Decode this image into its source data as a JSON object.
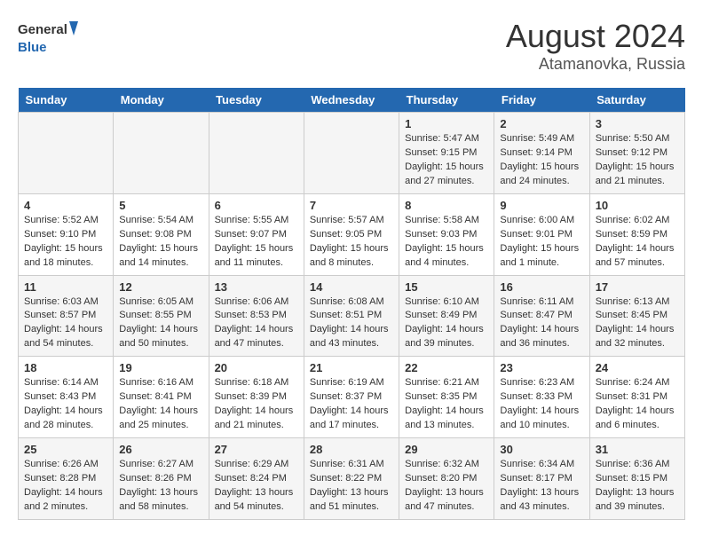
{
  "header": {
    "logo_line1": "General",
    "logo_line2": "Blue",
    "calendar_title": "August 2024",
    "calendar_subtitle": "Atamanovka, Russia"
  },
  "weekdays": [
    "Sunday",
    "Monday",
    "Tuesday",
    "Wednesday",
    "Thursday",
    "Friday",
    "Saturday"
  ],
  "weeks": [
    [
      {
        "day": "",
        "info": ""
      },
      {
        "day": "",
        "info": ""
      },
      {
        "day": "",
        "info": ""
      },
      {
        "day": "",
        "info": ""
      },
      {
        "day": "1",
        "info": "Sunrise: 5:47 AM\nSunset: 9:15 PM\nDaylight: 15 hours\nand 27 minutes."
      },
      {
        "day": "2",
        "info": "Sunrise: 5:49 AM\nSunset: 9:14 PM\nDaylight: 15 hours\nand 24 minutes."
      },
      {
        "day": "3",
        "info": "Sunrise: 5:50 AM\nSunset: 9:12 PM\nDaylight: 15 hours\nand 21 minutes."
      }
    ],
    [
      {
        "day": "4",
        "info": "Sunrise: 5:52 AM\nSunset: 9:10 PM\nDaylight: 15 hours\nand 18 minutes."
      },
      {
        "day": "5",
        "info": "Sunrise: 5:54 AM\nSunset: 9:08 PM\nDaylight: 15 hours\nand 14 minutes."
      },
      {
        "day": "6",
        "info": "Sunrise: 5:55 AM\nSunset: 9:07 PM\nDaylight: 15 hours\nand 11 minutes."
      },
      {
        "day": "7",
        "info": "Sunrise: 5:57 AM\nSunset: 9:05 PM\nDaylight: 15 hours\nand 8 minutes."
      },
      {
        "day": "8",
        "info": "Sunrise: 5:58 AM\nSunset: 9:03 PM\nDaylight: 15 hours\nand 4 minutes."
      },
      {
        "day": "9",
        "info": "Sunrise: 6:00 AM\nSunset: 9:01 PM\nDaylight: 15 hours\nand 1 minute."
      },
      {
        "day": "10",
        "info": "Sunrise: 6:02 AM\nSunset: 8:59 PM\nDaylight: 14 hours\nand 57 minutes."
      }
    ],
    [
      {
        "day": "11",
        "info": "Sunrise: 6:03 AM\nSunset: 8:57 PM\nDaylight: 14 hours\nand 54 minutes."
      },
      {
        "day": "12",
        "info": "Sunrise: 6:05 AM\nSunset: 8:55 PM\nDaylight: 14 hours\nand 50 minutes."
      },
      {
        "day": "13",
        "info": "Sunrise: 6:06 AM\nSunset: 8:53 PM\nDaylight: 14 hours\nand 47 minutes."
      },
      {
        "day": "14",
        "info": "Sunrise: 6:08 AM\nSunset: 8:51 PM\nDaylight: 14 hours\nand 43 minutes."
      },
      {
        "day": "15",
        "info": "Sunrise: 6:10 AM\nSunset: 8:49 PM\nDaylight: 14 hours\nand 39 minutes."
      },
      {
        "day": "16",
        "info": "Sunrise: 6:11 AM\nSunset: 8:47 PM\nDaylight: 14 hours\nand 36 minutes."
      },
      {
        "day": "17",
        "info": "Sunrise: 6:13 AM\nSunset: 8:45 PM\nDaylight: 14 hours\nand 32 minutes."
      }
    ],
    [
      {
        "day": "18",
        "info": "Sunrise: 6:14 AM\nSunset: 8:43 PM\nDaylight: 14 hours\nand 28 minutes."
      },
      {
        "day": "19",
        "info": "Sunrise: 6:16 AM\nSunset: 8:41 PM\nDaylight: 14 hours\nand 25 minutes."
      },
      {
        "day": "20",
        "info": "Sunrise: 6:18 AM\nSunset: 8:39 PM\nDaylight: 14 hours\nand 21 minutes."
      },
      {
        "day": "21",
        "info": "Sunrise: 6:19 AM\nSunset: 8:37 PM\nDaylight: 14 hours\nand 17 minutes."
      },
      {
        "day": "22",
        "info": "Sunrise: 6:21 AM\nSunset: 8:35 PM\nDaylight: 14 hours\nand 13 minutes."
      },
      {
        "day": "23",
        "info": "Sunrise: 6:23 AM\nSunset: 8:33 PM\nDaylight: 14 hours\nand 10 minutes."
      },
      {
        "day": "24",
        "info": "Sunrise: 6:24 AM\nSunset: 8:31 PM\nDaylight: 14 hours\nand 6 minutes."
      }
    ],
    [
      {
        "day": "25",
        "info": "Sunrise: 6:26 AM\nSunset: 8:28 PM\nDaylight: 14 hours\nand 2 minutes."
      },
      {
        "day": "26",
        "info": "Sunrise: 6:27 AM\nSunset: 8:26 PM\nDaylight: 13 hours\nand 58 minutes."
      },
      {
        "day": "27",
        "info": "Sunrise: 6:29 AM\nSunset: 8:24 PM\nDaylight: 13 hours\nand 54 minutes."
      },
      {
        "day": "28",
        "info": "Sunrise: 6:31 AM\nSunset: 8:22 PM\nDaylight: 13 hours\nand 51 minutes."
      },
      {
        "day": "29",
        "info": "Sunrise: 6:32 AM\nSunset: 8:20 PM\nDaylight: 13 hours\nand 47 minutes."
      },
      {
        "day": "30",
        "info": "Sunrise: 6:34 AM\nSunset: 8:17 PM\nDaylight: 13 hours\nand 43 minutes."
      },
      {
        "day": "31",
        "info": "Sunrise: 6:36 AM\nSunset: 8:15 PM\nDaylight: 13 hours\nand 39 minutes."
      }
    ]
  ]
}
